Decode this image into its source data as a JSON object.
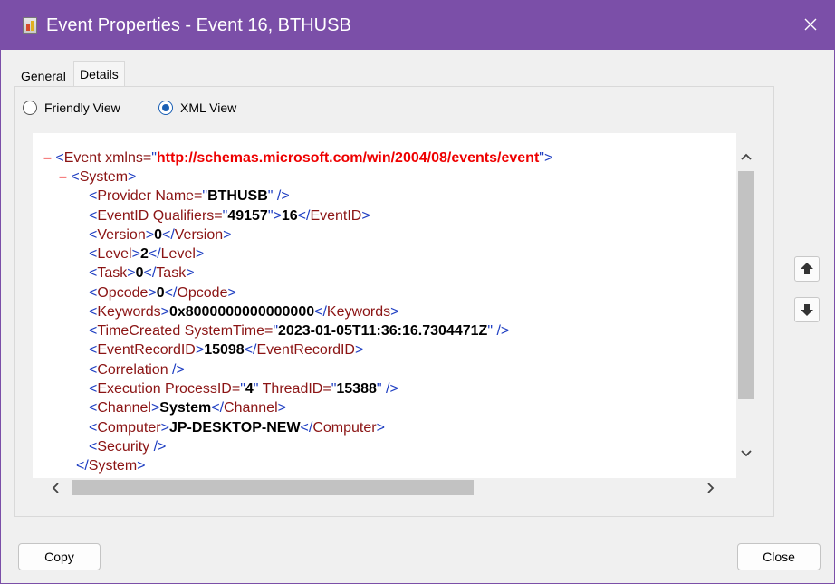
{
  "window": {
    "title": "Event Properties - Event 16, BTHUSB"
  },
  "tabs": [
    {
      "label": "General"
    },
    {
      "label": "Details"
    }
  ],
  "view_options": {
    "friendly": "Friendly View",
    "xml": "XML View",
    "selected": "XML View"
  },
  "xml": {
    "line0": {
      "minus": "–",
      "open": "<",
      "tag": "Event",
      "attr": " xmlns=",
      "q1": "\"",
      "value": "http://schemas.microsoft.com/win/2004/08/events/event",
      "q2": "\"",
      "close": ">"
    },
    "line1": {
      "minus": "–",
      "open": "<",
      "tag": "System",
      "close": ">"
    },
    "line2": {
      "open": "<",
      "tag": "Provider Name=",
      "q1": "\"",
      "value": "BTHUSB",
      "q2": "\"",
      "close": " />"
    },
    "line3": {
      "open": "<",
      "tag": "EventID Qualifiers=",
      "q1": "\"",
      "value": "49157",
      "q2": "\"",
      "gt": ">",
      "text": "16",
      "endopen": "</",
      "endtag": "EventID",
      "endclose": ">"
    },
    "line4": {
      "open": "<",
      "tag": "Version",
      "gt": ">",
      "text": "0",
      "endopen": "</",
      "endtag": "Version",
      "endclose": ">"
    },
    "line5": {
      "open": "<",
      "tag": "Level",
      "gt": ">",
      "text": "2",
      "endopen": "</",
      "endtag": "Level",
      "endclose": ">"
    },
    "line6": {
      "open": "<",
      "tag": "Task",
      "gt": ">",
      "text": "0",
      "endopen": "</",
      "endtag": "Task",
      "endclose": ">"
    },
    "line7": {
      "open": "<",
      "tag": "Opcode",
      "gt": ">",
      "text": "0",
      "endopen": "</",
      "endtag": "Opcode",
      "endclose": ">"
    },
    "line8": {
      "open": "<",
      "tag": "Keywords",
      "gt": ">",
      "text": "0x8000000000000000",
      "endopen": "</",
      "endtag": "Keywords",
      "endclose": ">"
    },
    "line9": {
      "open": "<",
      "tag": "TimeCreated SystemTime=",
      "q1": "\"",
      "value": "2023-01-05T11:36:16.7304471Z",
      "q2": "\"",
      "close": " />"
    },
    "line10": {
      "open": "<",
      "tag": "EventRecordID",
      "gt": ">",
      "text": "15098",
      "endopen": "</",
      "endtag": "EventRecordID",
      "endclose": ">"
    },
    "line11": {
      "open": "<",
      "tag": "Correlation",
      "close": " />"
    },
    "line12": {
      "open": "<",
      "tag": "Execution ProcessID=",
      "q1": "\"",
      "value": "4",
      "q2": "\"",
      "attr2": " ThreadID=",
      "q3": "\"",
      "value2": "15388",
      "q4": "\"",
      "close": " />"
    },
    "line13": {
      "open": "<",
      "tag": "Channel",
      "gt": ">",
      "text": "System",
      "endopen": "</",
      "endtag": "Channel",
      "endclose": ">"
    },
    "line14": {
      "open": "<",
      "tag": "Computer",
      "gt": ">",
      "text": "JP-DESKTOP-NEW",
      "endopen": "</",
      "endtag": "Computer",
      "endclose": ">"
    },
    "line15": {
      "open": "<",
      "tag": "Security",
      "close": " />"
    },
    "line16": {
      "endopen": "</",
      "endtag": "System",
      "endclose": ">"
    }
  },
  "buttons": {
    "copy": "Copy",
    "close": "Close"
  },
  "icons": {
    "close": "close-icon",
    "up": "arrow-up-icon",
    "down": "arrow-down-icon"
  },
  "colors": {
    "titlebar": "#7b4fa8",
    "xml_bracket": "#1e3ec2",
    "xml_tag": "#8b1414",
    "xml_minus": "#ee0000",
    "radio_selected": "#1a5fb4"
  }
}
